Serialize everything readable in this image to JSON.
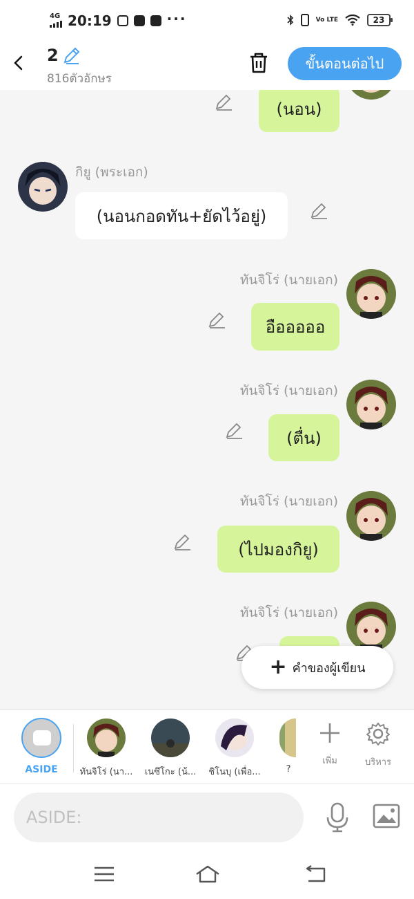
{
  "status_bar": {
    "network": "4G",
    "time": "20:19",
    "battery": "23",
    "volte": "Vo LTE"
  },
  "header": {
    "count": "2",
    "subtitle": "816ตัวอักษร",
    "next_button": "ขั้นตอนต่อไป"
  },
  "messages": [
    {
      "side": "right",
      "text": "(นอน)"
    },
    {
      "side": "left",
      "name": "กิยู (พระเอก)",
      "text": "(นอนกอดทัน+ยัดไว้อยู่)"
    },
    {
      "side": "right",
      "name": "ทันจิโร่ (นายเอก)",
      "text": "อือออออ"
    },
    {
      "side": "right",
      "name": "ทันจิโร่ (นายเอก)",
      "text": "(ตื่น)"
    },
    {
      "side": "right",
      "name": "ทันจิโร่ (นายเอก)",
      "text": "(ไปมองกิยู)"
    },
    {
      "side": "right",
      "name": "ทันจิโร่ (นายเอก)",
      "text": ""
    }
  ],
  "fab": {
    "label": "คำของผู้เขียน"
  },
  "charbar": {
    "aside_label": "ASIDE",
    "characters": [
      {
        "name": "ทันจิโร่ (นา..."
      },
      {
        "name": "เนซึโกะ (น้..."
      },
      {
        "name": "ชิโนบุ (เพื่อ..."
      },
      {
        "name": "? "
      }
    ],
    "add_label": "เพิ่ม",
    "manage_label": "บริหาร"
  },
  "input": {
    "placeholder": "ASIDE:"
  },
  "colors": {
    "accent": "#4aa3f0",
    "bubble_right": "#d6f59a",
    "bubble_left": "#ffffff"
  }
}
